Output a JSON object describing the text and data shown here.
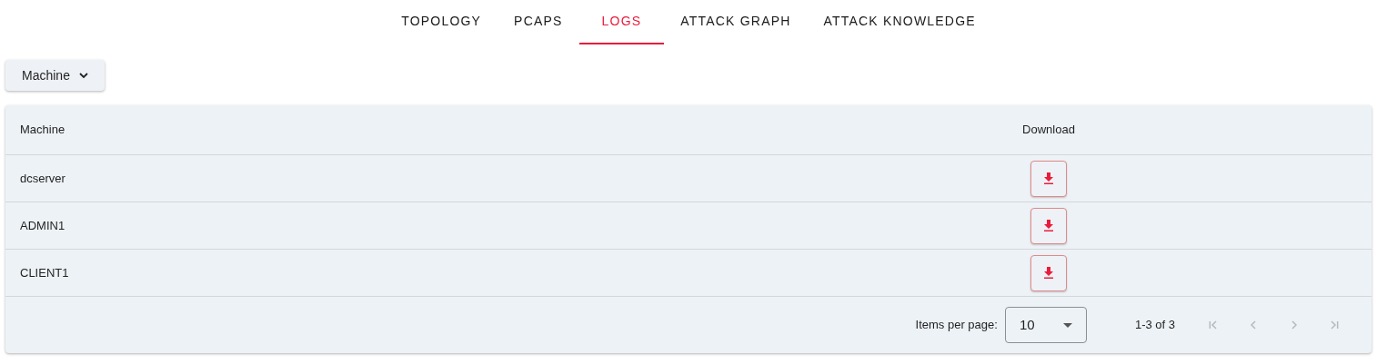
{
  "tabs": [
    {
      "label": "TOPOLOGY",
      "selected": false
    },
    {
      "label": "PCAPS",
      "selected": false
    },
    {
      "label": "LOGS",
      "selected": true
    },
    {
      "label": "ATTACK GRAPH",
      "selected": false
    },
    {
      "label": "ATTACK KNOWLEDGE",
      "selected": false
    }
  ],
  "filter_button": {
    "label": "Machine"
  },
  "table": {
    "columns": [
      "Machine",
      "Download"
    ],
    "rows": [
      {
        "machine": "dcserver"
      },
      {
        "machine": "ADMIN1"
      },
      {
        "machine": "CLIENT1"
      }
    ]
  },
  "pagination": {
    "items_per_page_label": "Items per page:",
    "page_size": "10",
    "range": "1-3 of 3",
    "buttons": [
      {
        "kind": "first",
        "disabled": true
      },
      {
        "kind": "prev",
        "disabled": true
      },
      {
        "kind": "next",
        "disabled": true
      },
      {
        "kind": "last",
        "disabled": true
      }
    ]
  }
}
